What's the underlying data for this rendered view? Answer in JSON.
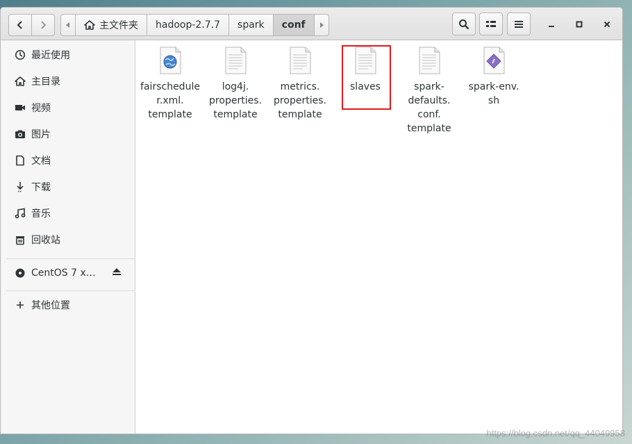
{
  "navigation": {
    "back_label": "‹",
    "forward_label": "›"
  },
  "pathbar": {
    "crumbs": [
      "主文件夹",
      "hadoop-2.7.7",
      "spark",
      "conf"
    ]
  },
  "sidebar": {
    "items": [
      {
        "label": "最近使用",
        "icon": "clock-icon"
      },
      {
        "label": "主目录",
        "icon": "home-icon"
      },
      {
        "label": "视频",
        "icon": "video-icon"
      },
      {
        "label": "图片",
        "icon": "camera-icon"
      },
      {
        "label": "文档",
        "icon": "document-icon"
      },
      {
        "label": "下载",
        "icon": "download-icon"
      },
      {
        "label": "音乐",
        "icon": "music-icon"
      },
      {
        "label": "回收站",
        "icon": "trash-icon"
      }
    ],
    "device": {
      "label": "CentOS 7 x…",
      "icon": "disc-icon"
    },
    "other": {
      "label": "其他位置",
      "icon": "plus-icon"
    }
  },
  "files": [
    {
      "name": "fairschedule\nr.xml.\ntemplate",
      "type": "xml"
    },
    {
      "name": "log4j.\nproperties.\ntemplate",
      "type": "text"
    },
    {
      "name": "metrics.\nproperties.\ntemplate",
      "type": "text"
    },
    {
      "name": "slaves",
      "type": "text",
      "highlighted": true
    },
    {
      "name": "spark-\ndefaults.\nconf.\ntemplate",
      "type": "text"
    },
    {
      "name": "spark-env.\nsh",
      "type": "script"
    }
  ],
  "watermark": "https://blog.csdn.net/qq_44049958",
  "colors": {
    "highlight_border": "#e0191c",
    "script_icon": "#8a6fc8"
  }
}
